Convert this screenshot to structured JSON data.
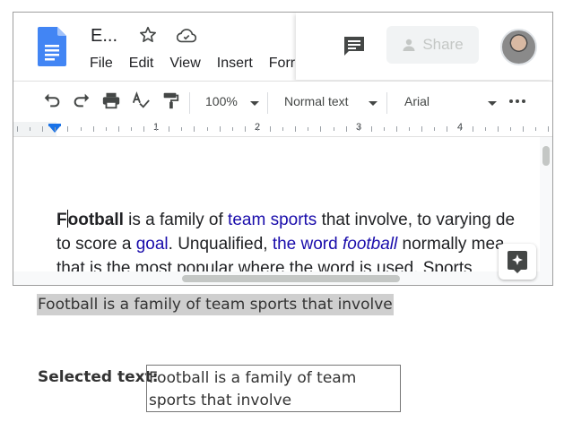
{
  "doc": {
    "title": "E...",
    "menu": [
      "File",
      "Edit",
      "View",
      "Insert",
      "Forr"
    ],
    "share_label": "Share"
  },
  "toolbar": {
    "zoom": "100%",
    "style": "Normal text",
    "font": "Arial"
  },
  "ruler": {
    "numbers": [
      "1",
      "2",
      "3",
      "4"
    ]
  },
  "body": {
    "line1": {
      "bold_f": "F",
      "bold_rest": "ootball",
      "t1": " is a family of ",
      "link1": "team sports",
      "t2": " that involve, to varying de"
    },
    "line2": {
      "t1": "to score a ",
      "link1": "goal",
      "t2": ". Unqualified, ",
      "link2": "the word ",
      "link2_italic": "football",
      "t3": " normally mea"
    },
    "line3": "that is the most popular where the word is used. Sports"
  },
  "highlight_text": "Football is a family of team sports that involve",
  "selected": {
    "label": "Selected text:",
    "value": "Football is a family of team sports that involve"
  }
}
